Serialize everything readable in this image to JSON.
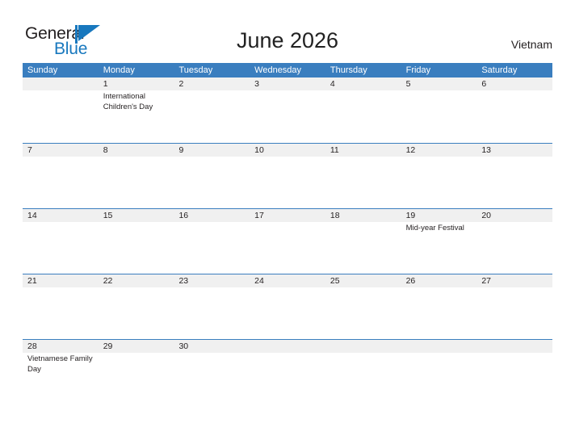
{
  "brand": {
    "name_part1": "General",
    "name_part2": "Blue",
    "flag_icon": "blue-flag-icon",
    "accent_color": "#1878be"
  },
  "header": {
    "title": "June 2026",
    "country": "Vietnam"
  },
  "theme": {
    "header_bar_color": "#3a7ebf",
    "date_band_color": "#f0f0f0",
    "rule_color": "#3a7ebf",
    "text_color": "#231f20"
  },
  "calendar": {
    "month": "June",
    "year": "2026",
    "weekdays": [
      "Sunday",
      "Monday",
      "Tuesday",
      "Wednesday",
      "Thursday",
      "Friday",
      "Saturday"
    ],
    "weeks": [
      [
        {
          "day": "",
          "events": []
        },
        {
          "day": "1",
          "events": [
            "International Children's Day"
          ]
        },
        {
          "day": "2",
          "events": []
        },
        {
          "day": "3",
          "events": []
        },
        {
          "day": "4",
          "events": []
        },
        {
          "day": "5",
          "events": []
        },
        {
          "day": "6",
          "events": []
        }
      ],
      [
        {
          "day": "7",
          "events": []
        },
        {
          "day": "8",
          "events": []
        },
        {
          "day": "9",
          "events": []
        },
        {
          "day": "10",
          "events": []
        },
        {
          "day": "11",
          "events": []
        },
        {
          "day": "12",
          "events": []
        },
        {
          "day": "13",
          "events": []
        }
      ],
      [
        {
          "day": "14",
          "events": []
        },
        {
          "day": "15",
          "events": []
        },
        {
          "day": "16",
          "events": []
        },
        {
          "day": "17",
          "events": []
        },
        {
          "day": "18",
          "events": []
        },
        {
          "day": "19",
          "events": [
            "Mid-year Festival"
          ]
        },
        {
          "day": "20",
          "events": []
        }
      ],
      [
        {
          "day": "21",
          "events": []
        },
        {
          "day": "22",
          "events": []
        },
        {
          "day": "23",
          "events": []
        },
        {
          "day": "24",
          "events": []
        },
        {
          "day": "25",
          "events": []
        },
        {
          "day": "26",
          "events": []
        },
        {
          "day": "27",
          "events": []
        }
      ],
      [
        {
          "day": "28",
          "events": [
            "Vietnamese Family Day"
          ]
        },
        {
          "day": "29",
          "events": []
        },
        {
          "day": "30",
          "events": []
        },
        {
          "day": "",
          "events": []
        },
        {
          "day": "",
          "events": []
        },
        {
          "day": "",
          "events": []
        },
        {
          "day": "",
          "events": []
        }
      ]
    ]
  }
}
